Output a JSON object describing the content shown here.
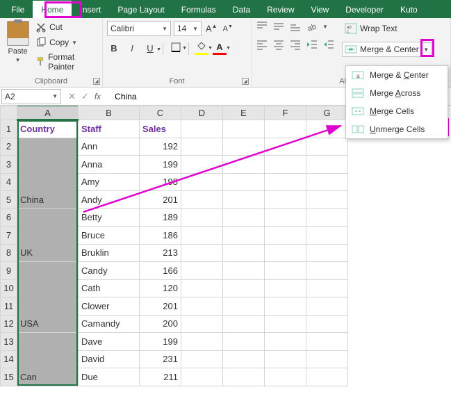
{
  "tabs": [
    "File",
    "Home",
    "Insert",
    "Page Layout",
    "Formulas",
    "Data",
    "Review",
    "View",
    "Developer",
    "Kuto"
  ],
  "active_tab_index": 1,
  "clipboard": {
    "paste": "Paste",
    "cut": "Cut",
    "copy": "Copy",
    "format_painter": "Format Painter",
    "group_label": "Clipboard"
  },
  "font": {
    "name": "Calibri",
    "size": "14",
    "group_label": "Font"
  },
  "alignment": {
    "wrap_text": "Wrap Text",
    "merge_center": "Merge & Center",
    "group_label": "Alignm"
  },
  "merge_menu": {
    "items": [
      "Merge & Center",
      "Merge Across",
      "Merge Cells",
      "Unmerge Cells"
    ],
    "accel_idx": [
      8,
      6,
      0,
      0
    ]
  },
  "namebox": "A2",
  "formula": "China",
  "columns": [
    "A",
    "B",
    "C",
    "D",
    "E",
    "F",
    "G"
  ],
  "headers": {
    "A": "Country",
    "B": "Staff",
    "C": "Sales"
  },
  "rows": [
    {
      "r": "1",
      "A": "Country",
      "B": "Staff",
      "C": "Sales",
      "hdr": true
    },
    {
      "r": "2",
      "A": "",
      "B": "Ann",
      "C": "192",
      "selA": true,
      "mergeTop": true,
      "mergeGroup": "China"
    },
    {
      "r": "3",
      "A": "",
      "B": "Anna",
      "C": "199",
      "selA": true
    },
    {
      "r": "4",
      "A": "",
      "B": "Amy",
      "C": "198",
      "selA": true
    },
    {
      "r": "5",
      "A": "China",
      "B": "Andy",
      "C": "201",
      "selA": true,
      "mergeBottom": true
    },
    {
      "r": "6",
      "A": "",
      "B": "Betty",
      "C": "189",
      "selA": true,
      "mergeTop": true,
      "mergeGroup": "UK"
    },
    {
      "r": "7",
      "A": "",
      "B": "Bruce",
      "C": "186",
      "selA": true
    },
    {
      "r": "8",
      "A": "UK",
      "B": "Bruklin",
      "C": "213",
      "selA": true,
      "mergeBottom": true
    },
    {
      "r": "9",
      "A": "",
      "B": "Candy",
      "C": "166",
      "selA": true,
      "mergeTop": true,
      "mergeGroup": "USA"
    },
    {
      "r": "10",
      "A": "",
      "B": "Cath",
      "C": "120",
      "selA": true
    },
    {
      "r": "11",
      "A": "",
      "B": "Clower",
      "C": "201",
      "selA": true
    },
    {
      "r": "12",
      "A": "USA",
      "B": "Camandy",
      "C": "200",
      "selA": true,
      "mergeBottom": true
    },
    {
      "r": "13",
      "A": "",
      "B": "Dave",
      "C": "199",
      "selA": true,
      "mergeTop": true,
      "mergeGroup": "Can"
    },
    {
      "r": "14",
      "A": "",
      "B": "David",
      "C": "231",
      "selA": true
    },
    {
      "r": "15",
      "A": "Can",
      "B": "Due",
      "C": "211",
      "selA": true
    }
  ],
  "colors": {
    "brand": "#217346",
    "highlight": "#e000d0",
    "header_text": "#7030a0",
    "fill_swatch": "#ffff00",
    "font_swatch": "#ff0000"
  }
}
